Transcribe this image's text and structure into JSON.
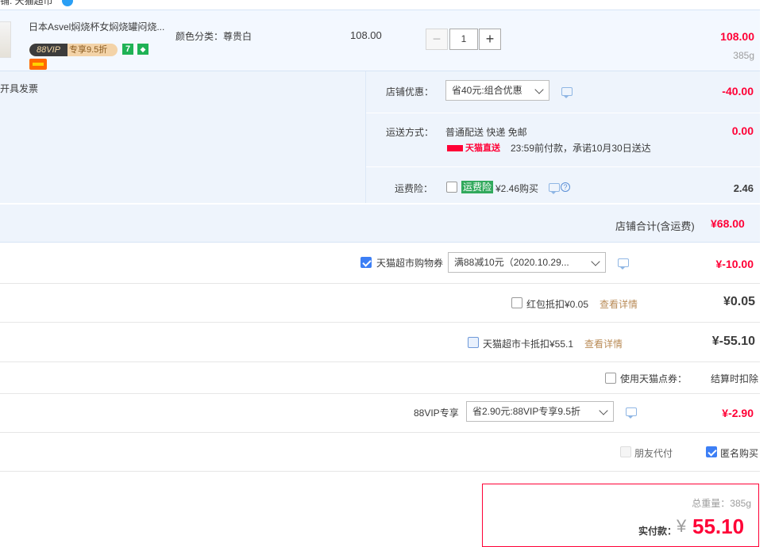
{
  "header": {
    "shop_name_partial": "铺: 天猫超市"
  },
  "item": {
    "name": "日本Asvel焖烧杯女焖烧罐闷烧...",
    "vip_badge_left": "88VIP",
    "vip_badge_right": "专享9.5折",
    "icon_seven": "7",
    "sku": "颜色分类：尊贵白",
    "unit_price": "108.00",
    "qty_minus": "−",
    "qty": "1",
    "qty_plus": "+",
    "total": "108.00",
    "weight": "385g"
  },
  "shop": {
    "invoice": "开具发票",
    "discount_label": "店铺优惠：",
    "discount_select": "省40元:组合优惠",
    "discount_amount": "-40.00",
    "shipping_label": "运送方式：",
    "shipping_method": "普通配送 快递 免邮",
    "tmall_logo_text": "天猫直送",
    "shipping_promise": "23:59前付款，承诺10月30日送达",
    "shipping_amount": "0.00",
    "insurance_label": "运费险：",
    "insurance_tag": "运费险",
    "insurance_price": "¥2.46购买",
    "insurance_amount": "2.46",
    "total_label": "店铺合计(含运费)",
    "total_amount": "¥68.00"
  },
  "order": {
    "coupon_label": "天猫超市购物券",
    "coupon_select": "满88减10元（2020.10.29...",
    "coupon_amount": "¥-10.00",
    "redpacket_label": "红包抵扣¥0.05",
    "redpacket_link": "查看详情",
    "redpacket_amount": "¥0.05",
    "card_label": "天猫超市卡抵扣¥55.1",
    "card_link": "查看详情",
    "card_amount": "¥-55.10",
    "points_label": "使用天猫点券：",
    "points_value": "结算时扣除",
    "vip_label": "88VIP专享",
    "vip_select": "省2.90元:88VIP专享9.5折",
    "vip_amount": "¥-2.90",
    "friend_pay": "朋友代付",
    "anonymous": "匿名购买"
  },
  "pay": {
    "weight_label": "总重量：385g",
    "actual_label": "实付款：",
    "currency": "¥",
    "actual_amount": "55.10"
  },
  "colors": {
    "accent_red": "#ff0036",
    "checkbox_blue": "#3d7ff5",
    "row_bg": "#eef4fc"
  }
}
